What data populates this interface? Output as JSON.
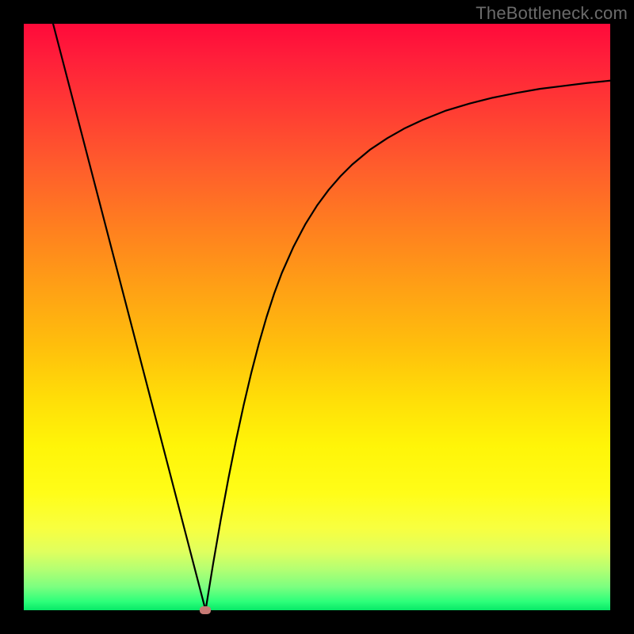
{
  "watermark": "TheBottleneck.com",
  "chart_data": {
    "type": "line",
    "title": "",
    "xlabel": "",
    "ylabel": "",
    "xlim": [
      0,
      1
    ],
    "ylim": [
      0,
      1
    ],
    "marker": {
      "x": 0.31,
      "y": 0.0
    },
    "series": [
      {
        "name": "curve",
        "x": [
          0.05,
          0.063,
          0.076,
          0.089,
          0.102,
          0.115,
          0.128,
          0.141,
          0.154,
          0.167,
          0.18,
          0.193,
          0.206,
          0.219,
          0.232,
          0.245,
          0.258,
          0.271,
          0.284,
          0.297,
          0.31,
          0.323,
          0.336,
          0.349,
          0.362,
          0.375,
          0.388,
          0.401,
          0.414,
          0.427,
          0.44,
          0.46,
          0.48,
          0.5,
          0.52,
          0.54,
          0.56,
          0.59,
          0.62,
          0.65,
          0.68,
          0.72,
          0.76,
          0.8,
          0.84,
          0.88,
          0.92,
          0.96,
          1.0
        ],
        "y": [
          1.0,
          0.95,
          0.9,
          0.85,
          0.8,
          0.75,
          0.7,
          0.65,
          0.6,
          0.55,
          0.5,
          0.45,
          0.4,
          0.35,
          0.3,
          0.25,
          0.2,
          0.15,
          0.1,
          0.05,
          0.0,
          0.08,
          0.155,
          0.225,
          0.29,
          0.35,
          0.405,
          0.455,
          0.5,
          0.54,
          0.575,
          0.62,
          0.658,
          0.69,
          0.717,
          0.74,
          0.76,
          0.785,
          0.805,
          0.822,
          0.836,
          0.852,
          0.864,
          0.874,
          0.882,
          0.889,
          0.894,
          0.899,
          0.903
        ]
      }
    ]
  }
}
